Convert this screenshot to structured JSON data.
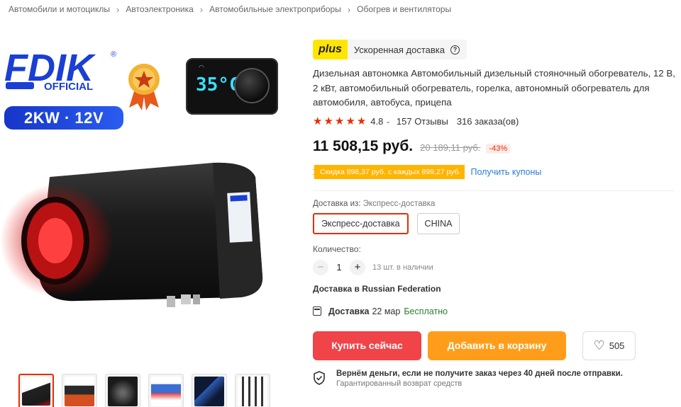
{
  "breadcrumb": [
    "Автомобили и мотоциклы",
    "Автоэлектроника",
    "Автомобильные электроприборы",
    "Обогрев и вентиляторы"
  ],
  "gallery": {
    "brand": "FDIK",
    "brand_sub": "OFFICIAL",
    "badge": "2KW · 12V",
    "controller_temp": "35°C",
    "thumbnail_count": 6
  },
  "product": {
    "plus_label": "plus",
    "fast_delivery": "Ускоренная доставка",
    "title": "Дизельная автономка Автомобильный дизельный стояночный обогреватель, 12 В, 2 кВт, автомобильный обогреватель, горелка, автономный обогреватель для автомобиля, автобуса, прицепа",
    "rating": "4.8",
    "rating_value": 4.8,
    "reviews": "157 Отзывы",
    "orders": "316 заказа(ов)",
    "price": "11 508,15 руб.",
    "old_price": "20 189,11 руб.",
    "discount": "-43%",
    "coupon": "Скидка 898,37 руб. с каждых 899,27 руб.",
    "coupon_link": "Получить купоны",
    "ship_from_label": "Доставка из:",
    "ship_from_value": "Экспресс-доставка",
    "ship_options": [
      "Экспресс-доставка",
      "CHINA"
    ],
    "qty_label": "Количество:",
    "qty": "1",
    "qty_minus": "−",
    "qty_plus": "+",
    "available": "13 шт. в наличии",
    "deliver_to": "Доставка в Russian Federation",
    "delivery_label": "Доставка",
    "delivery_date": "22 мар",
    "delivery_cost": "Бесплатно",
    "buy_now": "Купить сейчас",
    "add_to_cart": "Добавить в корзину",
    "wishlist_count": "505",
    "guarantee_main": "Вернём деньги, если не получите заказ через 40 дней после отправки.",
    "guarantee_sub": "Гарантированный возврат средств"
  },
  "colors": {
    "accent": "#e62e04",
    "buy": "#f04449",
    "cart": "#ff9d1a",
    "plus": "#ffe500",
    "coupon": "#ffb400",
    "link": "#2b7bd6"
  }
}
